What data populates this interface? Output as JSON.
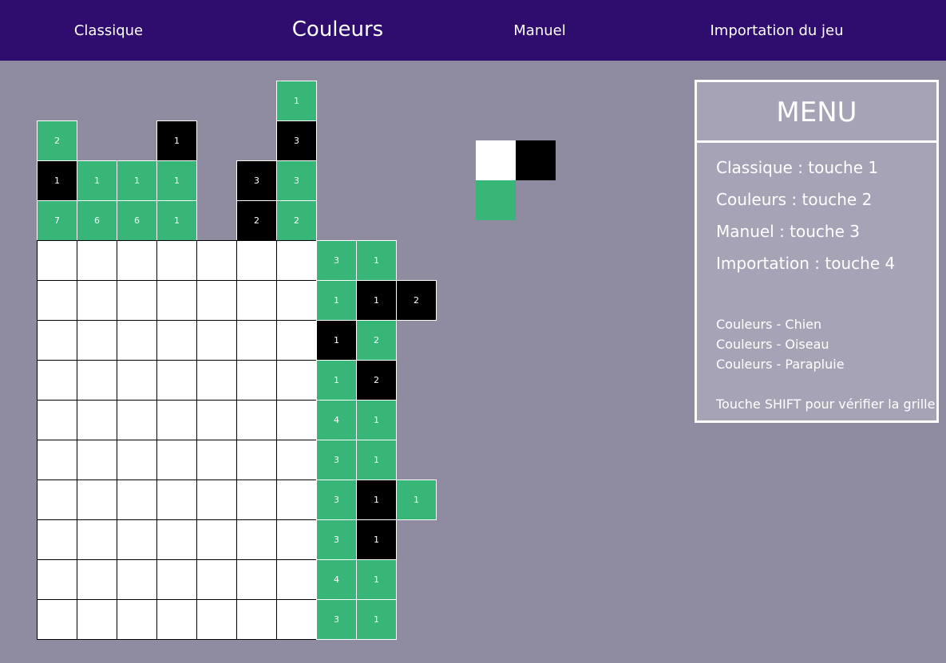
{
  "nav": {
    "classique": "Classique",
    "couleurs": "Couleurs",
    "manuel": "Manuel",
    "importation": "Importation du jeu"
  },
  "colors": {
    "topbar": "#2e0d6e",
    "background": "#8f8ca2",
    "green": "#37b677",
    "black": "#000000",
    "white": "#ffffff"
  },
  "palette": [
    "white",
    "black",
    "green"
  ],
  "column_clues": [
    [
      {
        "v": "2",
        "c": "green"
      },
      {
        "v": "1",
        "c": "black"
      },
      {
        "v": "7",
        "c": "green"
      }
    ],
    [
      {
        "v": "1",
        "c": "green"
      },
      {
        "v": "6",
        "c": "green"
      }
    ],
    [
      {
        "v": "1",
        "c": "green"
      },
      {
        "v": "6",
        "c": "green"
      }
    ],
    [
      {
        "v": "1",
        "c": "black"
      },
      {
        "v": "1",
        "c": "green"
      },
      {
        "v": "1",
        "c": "green"
      }
    ],
    [],
    [
      {
        "v": "3",
        "c": "black"
      },
      {
        "v": "2",
        "c": "black"
      }
    ],
    [
      {
        "v": "1",
        "c": "green"
      },
      {
        "v": "3",
        "c": "black"
      },
      {
        "v": "3",
        "c": "green"
      },
      {
        "v": "2",
        "c": "green"
      }
    ]
  ],
  "row_clues": [
    [
      {
        "v": "3",
        "c": "green"
      },
      {
        "v": "1",
        "c": "green"
      }
    ],
    [
      {
        "v": "1",
        "c": "green"
      },
      {
        "v": "1",
        "c": "black"
      },
      {
        "v": "2",
        "c": "black"
      }
    ],
    [
      {
        "v": "1",
        "c": "black"
      },
      {
        "v": "2",
        "c": "green"
      }
    ],
    [
      {
        "v": "1",
        "c": "green"
      },
      {
        "v": "2",
        "c": "black"
      }
    ],
    [
      {
        "v": "4",
        "c": "green"
      },
      {
        "v": "1",
        "c": "green"
      }
    ],
    [
      {
        "v": "3",
        "c": "green"
      },
      {
        "v": "1",
        "c": "green"
      }
    ],
    [
      {
        "v": "3",
        "c": "green"
      },
      {
        "v": "1",
        "c": "black"
      },
      {
        "v": "1",
        "c": "green"
      }
    ],
    [
      {
        "v": "3",
        "c": "green"
      },
      {
        "v": "1",
        "c": "black"
      }
    ],
    [
      {
        "v": "4",
        "c": "green"
      },
      {
        "v": "1",
        "c": "green"
      }
    ],
    [
      {
        "v": "3",
        "c": "green"
      },
      {
        "v": "1",
        "c": "green"
      }
    ]
  ],
  "grid": {
    "columns": 7,
    "rows": 10
  },
  "menu": {
    "title": "MENU",
    "shortcuts": [
      "Classique : touche 1",
      "Couleurs : touche 2",
      "Manuel : touche 3",
      "Importation : touche 4"
    ],
    "puzzles": [
      "Couleurs - Chien",
      "Couleurs - Oiseau",
      "Couleurs - Parapluie"
    ],
    "hint": "Touche SHIFT pour vérifier la grille"
  }
}
